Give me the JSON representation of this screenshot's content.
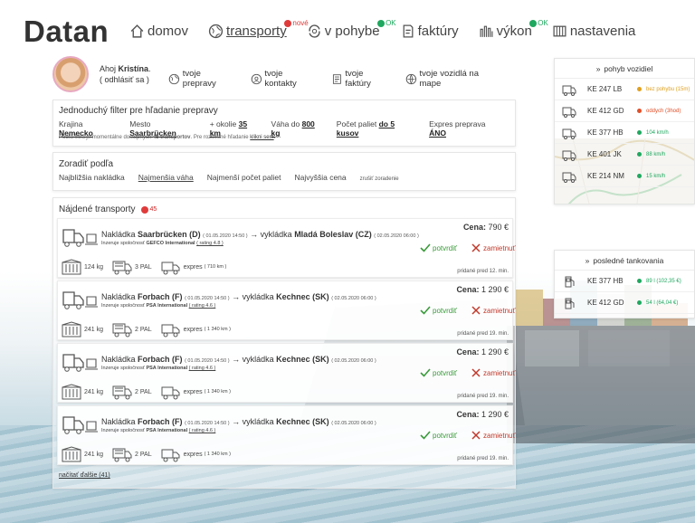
{
  "app": {
    "logo": "Datan"
  },
  "nav": [
    {
      "label": "domov",
      "icon": "home-icon",
      "active": false,
      "badge": null
    },
    {
      "label": "transporty",
      "icon": "globe-icon",
      "active": true,
      "badge": {
        "text": "nové",
        "color": "#e03b3b"
      }
    },
    {
      "label": "v pohybe",
      "icon": "moving-icon",
      "active": false,
      "badge": {
        "text": "OK",
        "color": "#1fa85f"
      }
    },
    {
      "label": "faktúry",
      "icon": "invoice-icon",
      "active": false,
      "badge": null
    },
    {
      "label": "výkon",
      "icon": "performance-icon",
      "active": false,
      "badge": {
        "text": "OK",
        "color": "#1fa85f"
      }
    },
    {
      "label": "nastavenia",
      "icon": "settings-icon",
      "active": false,
      "badge": null
    }
  ],
  "user": {
    "greeting": "Ahoj",
    "name": "Kristína",
    "logout": "( odhlásiť sa )",
    "links": [
      {
        "label": "tvoje prepravy",
        "icon": "globe-icon"
      },
      {
        "label": "tvoje kontakty",
        "icon": "contacts-icon"
      },
      {
        "label": "tvoje faktúry",
        "icon": "invoice-icon"
      },
      {
        "label": "tvoje vozidlá na mape",
        "icon": "map-icon"
      }
    ]
  },
  "filter": {
    "title": "Jednoduchý filter pre hľadanie prepravy",
    "items": [
      {
        "label": "Krajina",
        "value": "Nemecko"
      },
      {
        "label": "Mesto",
        "value": "Saarbrücken"
      },
      {
        "label": "+ okolie",
        "value": "35 km"
      },
      {
        "label": "Váha do",
        "value": "800 kg"
      },
      {
        "label": "Počet paliet",
        "value": "do 5 kusov"
      },
      {
        "label": "Expres preprava",
        "value": "ÁNO"
      }
    ],
    "note_prefix": "Podľa filtra je momentálne dostupných",
    "note_count": "45 transportov",
    "note_mid": ". Pre rozšírené hľadanie",
    "note_link": "klikni sem",
    "note_suffix": "."
  },
  "sort": {
    "title": "Zoradiť podľa",
    "options": [
      {
        "label": "Najbližšia nakládka",
        "selected": false
      },
      {
        "label": "Najmenšia váha",
        "selected": true
      },
      {
        "label": "Najmenší počet paliet",
        "selected": false
      },
      {
        "label": "Najvyššia cena",
        "selected": false
      }
    ],
    "reset": "zrušiť zoradenie"
  },
  "found": {
    "title": "Nájdené transporty",
    "count": "45",
    "load_more": "načítať ďalšie (41)",
    "accept_label": "potvrdiť",
    "reject_label": "zamietnuť",
    "price_label": "Cena:",
    "load_prefix": "Nakládka",
    "unload_prefix": "vykládka",
    "company_prefix": "Inzeruje spoločnosť",
    "items": [
      {
        "from": "Saarbrücken (D)",
        "from_date": "( 01.05.2020 14:50 )",
        "to": "Mladá Boleslav (CZ)",
        "to_date": "( 02.05.2020 06:00 )",
        "company": "GEFCO International",
        "rating": "( rating 4.8 )",
        "price": "790 €",
        "weight": "124 kg",
        "pallets": "3 PAL",
        "express": "expres",
        "express_dist": "( 710 km )",
        "added": "pridané pred 12. min."
      },
      {
        "from": "Forbach (F)",
        "from_date": "( 01.05.2020 14:50 )",
        "to": "Kechnec (SK)",
        "to_date": "( 02.05.2020 06:00 )",
        "company": "PSA International",
        "rating": "( rating 4.6 )",
        "price": "1 290 €",
        "weight": "241 kg",
        "pallets": "2 PAL",
        "express": "expres",
        "express_dist": "( 1 340 km )",
        "added": "pridané pred 19. min."
      },
      {
        "from": "Forbach (F)",
        "from_date": "( 01.05.2020 14:50 )",
        "to": "Kechnec (SK)",
        "to_date": "( 02.05.2020 06:00 )",
        "company": "PSA International",
        "rating": "( rating 4.6 )",
        "price": "1 290 €",
        "weight": "241 kg",
        "pallets": "2 PAL",
        "express": "expres",
        "express_dist": "( 1 340 km )",
        "added": "pridané pred 19. min."
      },
      {
        "from": "Forbach (F)",
        "from_date": "( 01.05.2020 14:50 )",
        "to": "Kechnec (SK)",
        "to_date": "( 02.05.2020 06:00 )",
        "company": "PSA International",
        "rating": "( rating 4.6 )",
        "price": "1 290 €",
        "weight": "241 kg",
        "pallets": "2 PAL",
        "express": "expres",
        "express_dist": "( 1 340 km )",
        "added": "pridané pred 19. min."
      }
    ]
  },
  "vehicles": {
    "title": "pohyb vozidiel",
    "items": [
      {
        "plate": "KE 247 LB",
        "status": "bez pohybu (15m)",
        "color": "#e0a020",
        "icon": "stopped-vehicle-icon"
      },
      {
        "plate": "KE 412 GD",
        "status": "oddych (3hod)",
        "color": "#e0502a",
        "icon": "resting-vehicle-icon"
      },
      {
        "plate": "KE 377 HB",
        "status": "104 km/h",
        "color": "#1fa85f",
        "icon": "truck-icon"
      },
      {
        "plate": "KE 401 JK",
        "status": "88 km/h",
        "color": "#1fa85f",
        "icon": "truck-icon"
      },
      {
        "plate": "KE 214 NM",
        "status": "15 km/h",
        "color": "#1fa85f",
        "icon": "truck-icon"
      }
    ]
  },
  "refuel": {
    "title": "posledné tankovania",
    "items": [
      {
        "plate": "KE 377 HB",
        "status": "89 l (102,35 €)",
        "color": "#1fa85f"
      },
      {
        "plate": "KE 412 GD",
        "status": "54 l (64,04 €)",
        "color": "#1fa85f"
      }
    ]
  }
}
